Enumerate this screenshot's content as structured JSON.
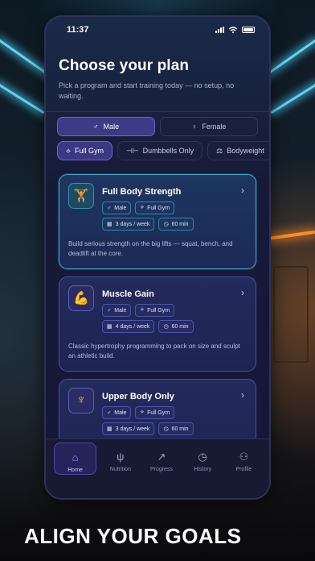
{
  "status_bar": {
    "time": "11:37"
  },
  "header": {
    "title": "Choose your plan",
    "subtitle": "Pick a program and start training today — no setup, no waiting."
  },
  "gender": [
    {
      "symbol": "♂",
      "label": "Male",
      "selected": true
    },
    {
      "symbol": "♀",
      "label": "Female",
      "selected": false
    }
  ],
  "equipment": [
    {
      "symbol": "⟡",
      "label": "Full Gym",
      "selected": true
    },
    {
      "symbol": "⊣⊢",
      "label": "Dumbbells Only",
      "selected": false
    },
    {
      "symbol": "⚖",
      "label": "Bodyweight",
      "selected": false
    }
  ],
  "plans": [
    {
      "icon": "🏋",
      "name": "Full Body Strength",
      "gender_tag": "Male",
      "equipment_tag": "Full Gym",
      "frequency": "3 days / week",
      "duration": "60 min",
      "description": "Build serious strength on the big lifts — squat, bench, and deadlift at the core."
    },
    {
      "icon": "💪",
      "name": "Muscle Gain",
      "gender_tag": "Male",
      "equipment_tag": "Full Gym",
      "frequency": "4 days / week",
      "duration": "60 min",
      "description": "Classic hypertrophy programming to pack on size and sculpt an athletic build."
    },
    {
      "icon": "♆",
      "name": "Upper Body Only",
      "gender_tag": "Male",
      "equipment_tag": "Full Gym",
      "frequency": "3 days / week",
      "duration": "60 min",
      "description": ""
    }
  ],
  "tabs": [
    {
      "icon": "⌂",
      "label": "Home"
    },
    {
      "icon": "ψ",
      "label": "Nutrition"
    },
    {
      "icon": "↗",
      "label": "Progress"
    },
    {
      "icon": "◷",
      "label": "History"
    },
    {
      "icon": "⚇",
      "label": "Profile"
    }
  ],
  "headline": "ALIGN YOUR GOALS",
  "colors": {
    "accent": "#6d63d9",
    "selected_card_border": "#3fa7c9",
    "card_border": "#4a4fa0",
    "screen_bg": "#14163a"
  }
}
